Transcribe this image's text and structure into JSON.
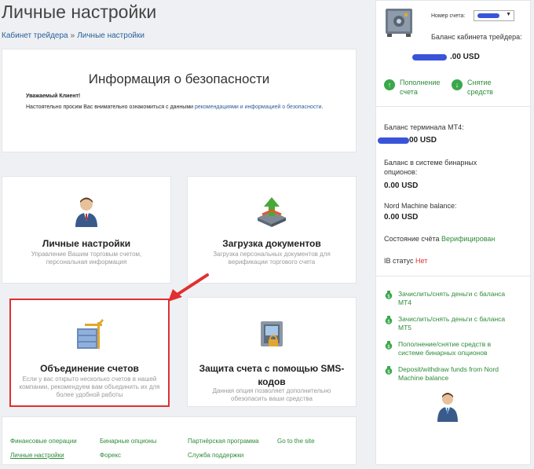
{
  "page": {
    "title": "Личные настройки",
    "breadcrumb": [
      "Кабинет трейдера",
      "Личные настройки"
    ],
    "breadcrumb_sep": "»"
  },
  "security": {
    "heading": "Информация о безопасности",
    "greeting": "Уважаемый Клиент!",
    "text_before": "Настоятельно просим Вас внимательно ознакомиться с данными ",
    "link_text": "рекомендациями и информацией о безопасности",
    "text_after": "."
  },
  "tiles": [
    {
      "title": "Личные настройки",
      "desc": "Управление Вашим торговым счетом, персональная информация",
      "icon": "user-icon"
    },
    {
      "title": "Загрузка документов",
      "desc": "Загрузка персональных документов для верификации торгового счета",
      "icon": "upload-icon"
    },
    {
      "title": "Объединение счетов",
      "desc": "Если у вас открыто несколько счетов в нашей компании, рекомендуем вам объединить их для более удобной работы",
      "icon": "merge-accounts-icon"
    },
    {
      "title": "Защита счета с помощью SMS-кодов",
      "desc": "Данная опция позволяет дополнительно обезопасить ваши средства",
      "icon": "sms-lock-icon"
    }
  ],
  "footer_links": [
    "Финансовые операции",
    "Бинарные опционы",
    "Партнёрская программа",
    "Go to the site",
    "Личные настройки",
    "Форекс",
    "Служба поддержки"
  ],
  "sidebar": {
    "account_label": "Номер счета:",
    "balance_label": "Баланс кабинета трейдера:",
    "balance_value": ".00 USD",
    "deposit": "Пополнение счета",
    "withdraw": "Снятие средств",
    "mt4_label": "Баланс терминала МТ4:",
    "mt4_value": "00 USD",
    "binary_label": "Баланс в системе бинарных опционов:",
    "binary_value": "0.00 USD",
    "nm_label": "Nord Machine balance:",
    "nm_value": "0.00 USD",
    "status_label": "Состояние счёта",
    "status_value": "Верифицирован",
    "ib_label": "IB статус",
    "ib_value": "Нет",
    "money_links": [
      "Зачислить/снять деньги с баланса МТ4",
      "Зачислить/снять деньги с баланса МТ5",
      "Пополнение/снятие средств в системе бинарных опционов",
      "Deposit/withdraw funds from Nord Machine balance"
    ]
  },
  "colors": {
    "accent_green": "#2e8b3a",
    "link_blue": "#2b5f99",
    "highlight_red": "#e03030",
    "redaction_blue": "#3a54d9"
  }
}
